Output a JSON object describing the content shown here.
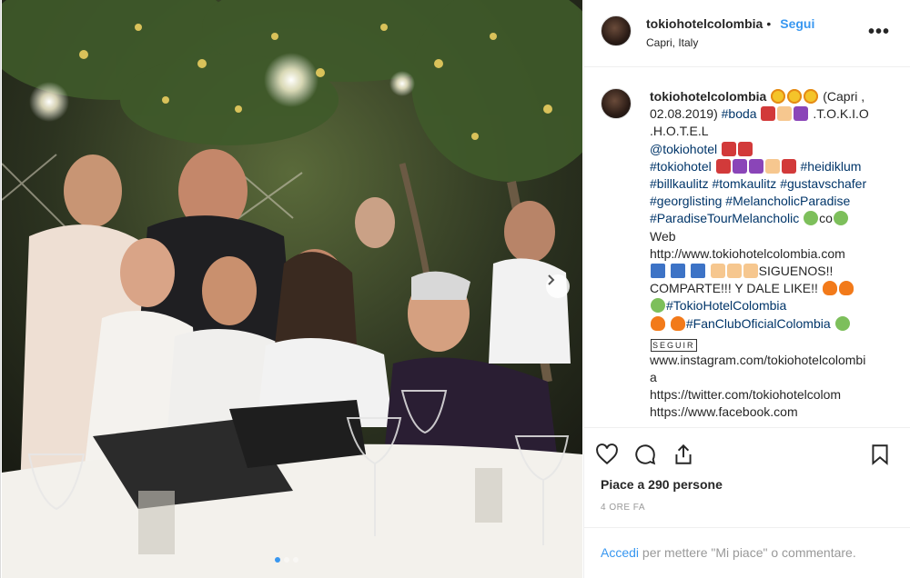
{
  "post": {
    "username": "tokiohotelcolombia",
    "separator": "•",
    "follow_label": "Segui",
    "location": "Capri, Italy",
    "more_label": "•••"
  },
  "caption": {
    "username": "tokiohotelcolombia",
    "lines": [
      " (Capri ,",
      "02.08.2019) ",
      "#boda",
      " .T.O.K.I.O",
      ".H.O.T.E.L",
      "@tokiohotel",
      "#tokiohotel",
      "#heidiklum",
      "#billkaulitz",
      "#tomkaulitz",
      "#gustavschafer",
      "#georglisting",
      "#MelancholicParadise",
      "#ParadiseTourMelancholic",
      "co",
      "Web",
      "http://www.tokiohotelcolombia.com",
      "SIGUENOS!!",
      "COMPARTE!!! Y DALE LIKE!!",
      "#TokioHotelColombia",
      "#FanClubOficialColombia",
      "SEGUIR",
      "www.instagram.com/tokiohotelcolombi",
      "a",
      "https://twitter.com/tokiohotelcolom",
      "https://www.facebook.com"
    ]
  },
  "engagement": {
    "likes_text": "Piace a 290 persone",
    "time_text": "4 ORE FA"
  },
  "login": {
    "link_label": "Accedi",
    "rest_label": " per mettere \"Mi piace\" o commentare."
  },
  "icons": {
    "like": "heart-icon",
    "comment": "comment-icon",
    "share": "share-icon",
    "save": "bookmark-icon",
    "next": "chevron-right-icon"
  },
  "colors": {
    "link": "#3897f0",
    "hashtag": "#003569",
    "carousel_active": "#3897f0"
  }
}
